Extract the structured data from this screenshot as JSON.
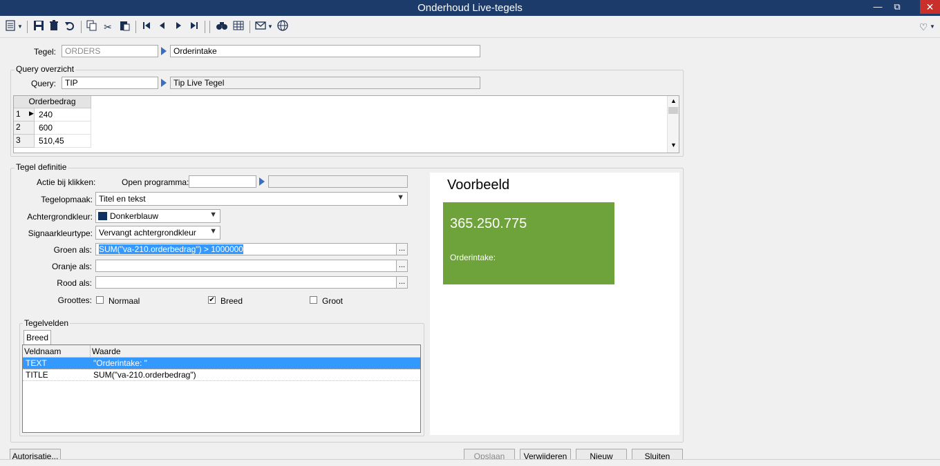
{
  "window": {
    "title": "Onderhoud Live-tegels",
    "controls": {
      "minimize": "—",
      "maximize": "⧉",
      "close": "✕"
    }
  },
  "toolbar": {
    "icons": [
      "menu-icon",
      "save-icon",
      "delete-icon",
      "undo-icon",
      "copy-icon",
      "cut-icon",
      "paste-icon",
      "first-record-icon",
      "previous-record-icon",
      "next-record-icon",
      "last-record-icon",
      "find-icon",
      "table-icon",
      "mail-icon",
      "globe-icon",
      "favorite-icon"
    ]
  },
  "tile": {
    "label": "Tegel:",
    "code": "ORDERS",
    "name": "Orderintake"
  },
  "query_overview": {
    "title": "Query overzicht",
    "label": "Query:",
    "code": "TIP",
    "name": "Tip Live Tegel",
    "grid": {
      "column": "Orderbedrag",
      "rows": [
        {
          "num": "1",
          "value": "240"
        },
        {
          "num": "2",
          "value": "600"
        },
        {
          "num": "3",
          "value": "510,45"
        }
      ]
    }
  },
  "tile_definition": {
    "title": "Tegel definitie",
    "action_label": "Actie bij klikken:",
    "open_program_label": "Open programma:",
    "open_program_value": "",
    "open_program_desc": "",
    "layout_label": "Tegelopmaak:",
    "layout_value": "Titel en tekst",
    "bg_label": "Achtergrondkleur:",
    "bg_value": "Donkerblauw",
    "bg_swatch": "#0f3460",
    "signal_label": "Signaarkleurtype:",
    "signal_value": "Vervangt achtergrondkleur",
    "green_label": "Groen als:",
    "green_value": "SUM(\"va-210.orderbedrag\") > 1000000",
    "orange_label": "Oranje als:",
    "orange_value": "",
    "red_label": "Rood als:",
    "red_value": "",
    "sizes_label": "Groottes:",
    "sizes": [
      {
        "label": "Normaal",
        "checked": false
      },
      {
        "label": "Breed",
        "checked": true
      },
      {
        "label": "Groot",
        "checked": false
      }
    ],
    "dots": "..."
  },
  "tile_fields": {
    "title": "Tegelvelden",
    "tab": "Breed",
    "columns": [
      "Veldnaam",
      "Waarde"
    ],
    "rows": [
      {
        "name": "TEXT",
        "value": "\"Orderintake: \"",
        "selected": true
      },
      {
        "name": "TITLE",
        "value": "SUM(\"va-210.orderbedrag\")",
        "selected": false
      }
    ]
  },
  "preview": {
    "title": "Voorbeeld",
    "tile_value": "365.250.775",
    "tile_text": "Orderintake:",
    "tile_color": "#6ea23a"
  },
  "buttons": {
    "authorization": "Autorisatie...",
    "save": "Opslaan",
    "delete": "Verwijderen",
    "new": "Nieuw",
    "close": "Sluiten"
  }
}
